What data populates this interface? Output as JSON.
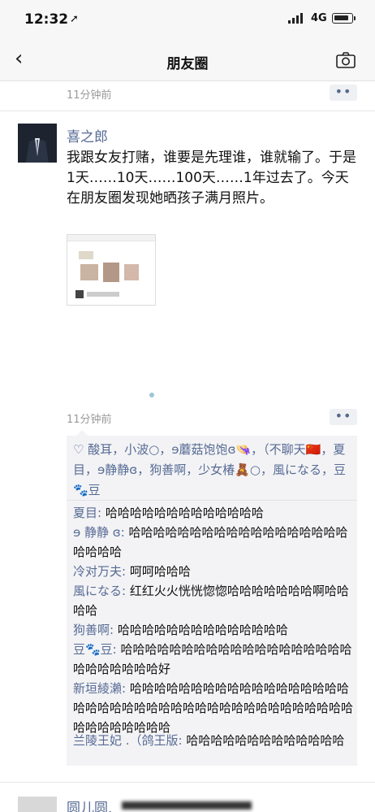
{
  "status": {
    "time": "12:32",
    "network": "4G"
  },
  "nav": {
    "title": "朋友圈"
  },
  "prev_post": {
    "time": "11分钟前",
    "more": "••"
  },
  "post": {
    "author": "喜之郎",
    "text": "我跟女友打赌，谁要是先理谁，谁就输了。于是1天……10天……100天……1年过去了。今天在朋友圈发现她晒孩子满月照片。",
    "time": "11分钟前",
    "more": "••",
    "likes": "♡ 酸耳，小波○，ɘ蘑菇饱饱ɞ👒，（不聊天🇨🇳，夏目，ɘ静静ɞ，狗善啊，少女椿🧸○，風になる，豆🐾豆",
    "comments": [
      {
        "user": "夏目:",
        "text": " 哈哈哈哈哈哈哈哈哈哈哈哈哈"
      },
      {
        "user": "ɘ 静静 ɞ:",
        "text": " 哈哈哈哈哈哈哈哈哈哈哈哈哈哈哈哈哈哈哈哈哈哈"
      },
      {
        "user": "冷对万夫:",
        "text": " 呵呵哈哈哈"
      },
      {
        "user": "風になる:",
        "text": " 红红火火恍恍惚惚哈哈哈哈哈哈哈啊哈哈哈哈"
      },
      {
        "user": "狗善啊:",
        "text": " 哈哈哈哈哈哈哈哈哈哈哈哈哈哈"
      },
      {
        "user": "豆🐾豆:",
        "text": " 哈哈哈哈哈哈哈哈哈哈哈哈哈哈哈哈哈哈哈哈哈哈哈哈哈哈好"
      },
      {
        "user": "新垣綾瀨:",
        "text": " 哈哈哈哈哈哈哈哈哈哈哈哈哈哈哈哈哈哈哈哈哈哈哈哈哈哈哈哈哈哈哈哈哈哈哈哈哈哈哈哈哈哈哈哈哈哈哈哈哈"
      },
      {
        "user": "兰陵王妃 .（鸽王版:",
        "text": " 哈哈哈哈哈哈哈哈哈哈哈哈哈"
      }
    ]
  },
  "next_post": {
    "author": "圆儿圆."
  },
  "colors": {
    "link": "#576b95",
    "bg": "#ffffff",
    "box": "#f3f3f5"
  }
}
